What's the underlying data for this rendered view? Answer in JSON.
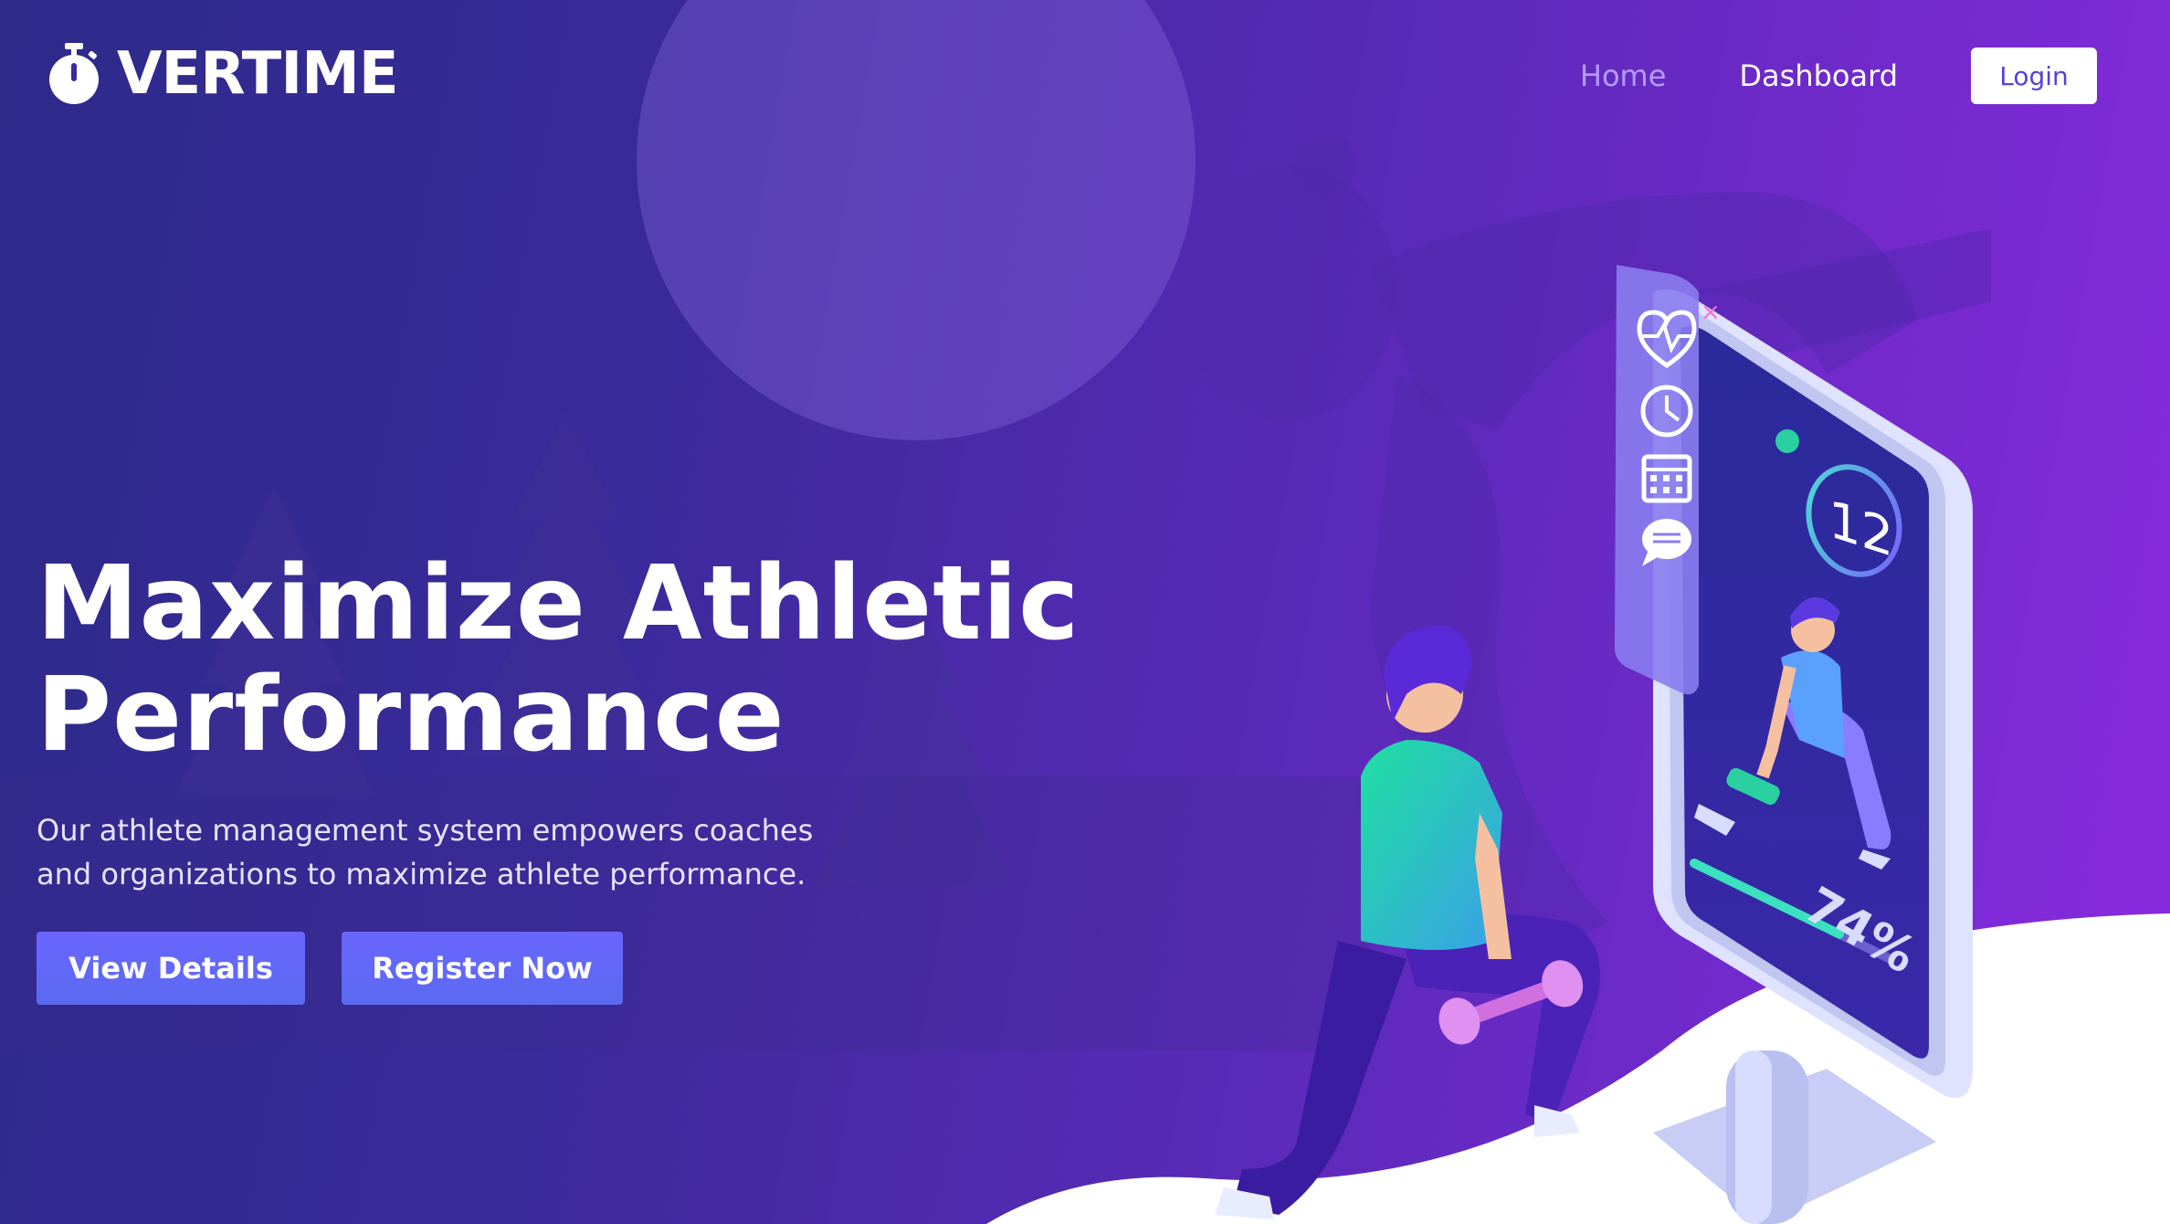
{
  "brand": {
    "name": "VERTIME",
    "icon": "stopwatch-icon"
  },
  "nav": {
    "items": [
      {
        "label": "Home",
        "active": true
      },
      {
        "label": "Dashboard",
        "active": false
      }
    ],
    "login_label": "Login"
  },
  "hero": {
    "title_line1": "Maximize Athletic",
    "title_line2": "Performance",
    "subtitle": "Our athlete management system empowers coaches and organizations to maximize athlete performance.",
    "buttons": {
      "view_details": "View Details",
      "register": "Register Now"
    }
  },
  "phone_screen": {
    "counter": "12",
    "progress_label": "74%",
    "progress": 0.74,
    "side_icons": [
      "heartbeat-icon",
      "clock-icon",
      "calendar-icon",
      "chat-icon"
    ]
  },
  "colors": {
    "bg_start": "#2d2a8a",
    "bg_end": "#8a2ae0",
    "accent": "#6a66ff",
    "nav_active": "#b39dff"
  }
}
